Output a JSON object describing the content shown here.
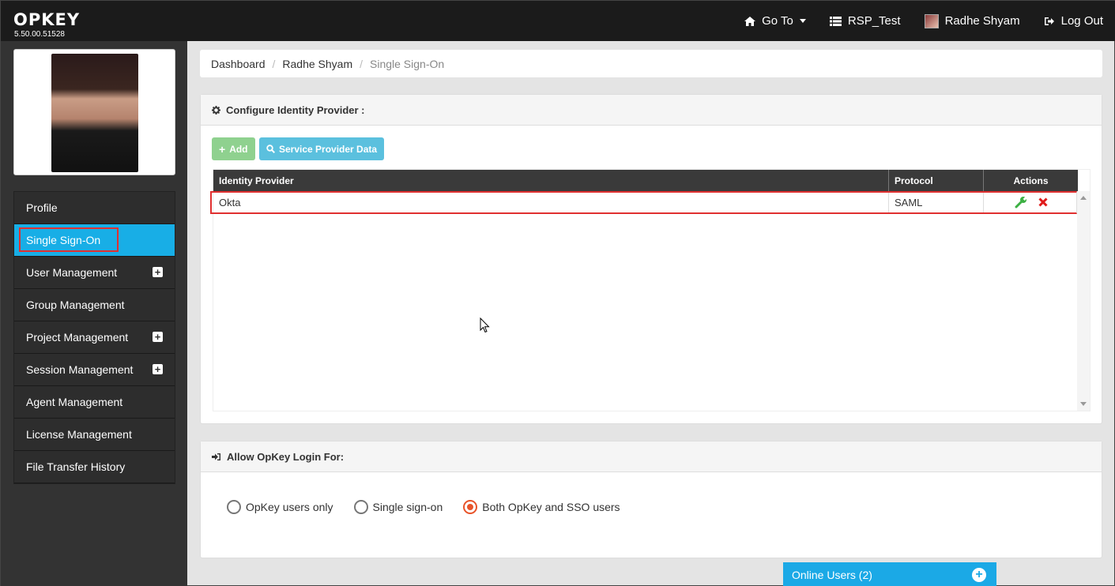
{
  "app": {
    "logo": "OPKEY",
    "version": "5.50.00.51528"
  },
  "topnav": {
    "goto_label": "Go To",
    "project_label": "RSP_Test",
    "user_label": "Radhe Shyam",
    "logout_label": "Log Out"
  },
  "sidebar": {
    "items": [
      {
        "label": "Profile"
      },
      {
        "label": "Single Sign-On"
      },
      {
        "label": "User Management"
      },
      {
        "label": "Group Management"
      },
      {
        "label": "Project Management"
      },
      {
        "label": "Session Management"
      },
      {
        "label": "Agent Management"
      },
      {
        "label": "License Management"
      },
      {
        "label": "File Transfer History"
      }
    ],
    "active_index": 1
  },
  "breadcrumb": {
    "items": [
      "Dashboard",
      "Radhe Shyam",
      "Single Sign-On"
    ]
  },
  "identity_panel": {
    "title": "Configure Identity Provider :",
    "add_label": "Add",
    "sp_data_label": "Service Provider Data",
    "columns": [
      "Identity Provider",
      "Protocol",
      "Actions"
    ],
    "rows": [
      {
        "provider": "Okta",
        "protocol": "SAML"
      }
    ]
  },
  "login_panel": {
    "title": "Allow OpKey Login For:",
    "options": [
      "OpKey users only",
      "Single sign-on",
      "Both OpKey and SSO users"
    ],
    "selected_index": 2
  },
  "online_users": {
    "label": "Online Users (2)"
  },
  "colors": {
    "accent": "#18aee6",
    "highlight": "#e03030",
    "radio_selected": "#e8542a"
  }
}
